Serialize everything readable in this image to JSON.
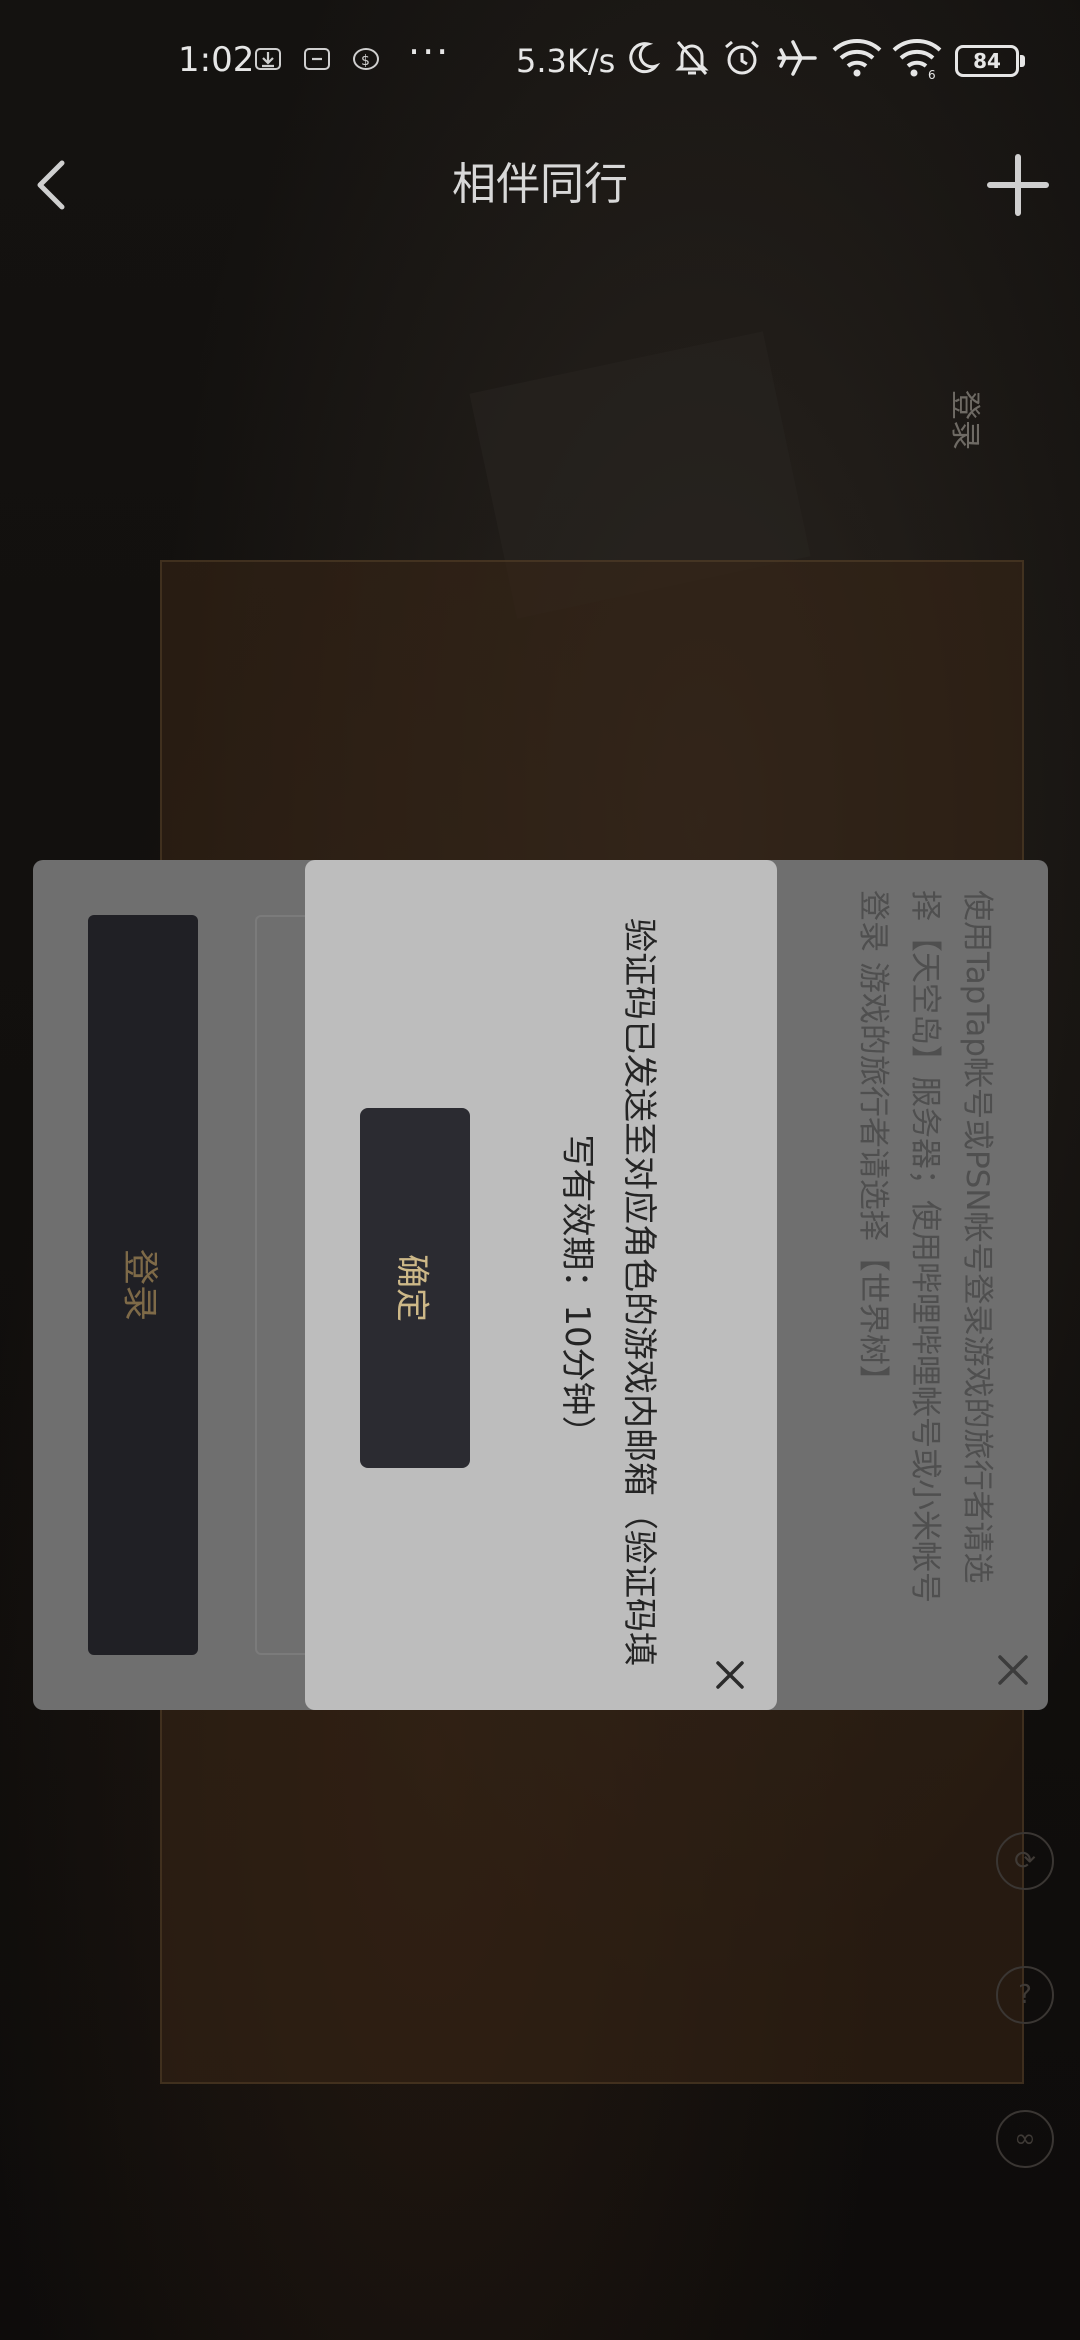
{
  "status_bar": {
    "time": "1:02",
    "dots": "···",
    "net_speed": "5.3K/s",
    "battery": "84",
    "icons": [
      "download-icon",
      "sim-icon",
      "dollar-icon",
      "moon-icon",
      "bell-off-icon",
      "alarm-icon",
      "airplane-icon",
      "wifi-icon",
      "wifi6-icon",
      "battery-icon"
    ]
  },
  "header": {
    "title": "相伴同行",
    "back_icon": "chevron-left-icon",
    "add_icon": "plus-icon"
  },
  "background": {
    "login_label_rotated": "登录",
    "side_icons": [
      "refresh-icon",
      "help-icon",
      "link-icon"
    ]
  },
  "login_sheet": {
    "login_button_label": "登录",
    "info_text": "使用TapTap帐号或PSN帐号登录游戏的旅行者请选择【天空岛】服务器；使用哔哩哔哩帐号或小米帐号登录 游戏的旅行者请选择【世界树】",
    "close_icon": "close-icon"
  },
  "dialog": {
    "message": "验证码已发送至对应角色的游戏内邮箱（验证码填写有效期：10分钟）",
    "confirm_label": "确定",
    "close_icon": "close-icon"
  },
  "colors": {
    "dialog_bg": "#bdbdbd",
    "sheet_bg": "#6f6f6f",
    "button_dark": "#2b2b31",
    "button_text_gold": "#cdb888"
  }
}
